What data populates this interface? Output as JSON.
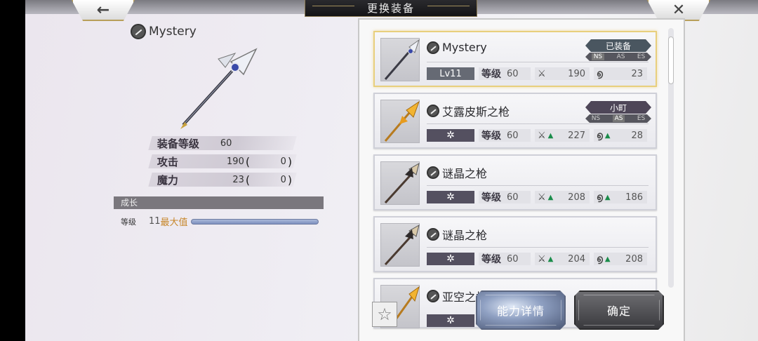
{
  "header": {
    "title": "更换装备",
    "back_icon": "←",
    "close_icon": "✕"
  },
  "selected": {
    "name": "Mystery",
    "stats": [
      {
        "label": "装备等级",
        "value": "60"
      },
      {
        "label": "攻击",
        "value": "190",
        "bonus": "0"
      },
      {
        "label": "魔力",
        "value": "23",
        "bonus": "0"
      }
    ],
    "growth": {
      "section_label": "成长",
      "label": "等级",
      "level": "11",
      "max_label": "最大值"
    }
  },
  "list": [
    {
      "name": "Mystery",
      "tag": "Lv11",
      "grade_label": "等级",
      "grade": "60",
      "atk": "190",
      "mag": "23",
      "atk_up": false,
      "mag_up": false,
      "badge": "已装备",
      "ns": [
        "NS",
        "AS",
        "ES"
      ],
      "ns_active": "NS",
      "equipped": true
    },
    {
      "name": "艾露皮斯之枪",
      "tag": "✲",
      "grade_label": "等级",
      "grade": "60",
      "atk": "227",
      "mag": "28",
      "atk_up": true,
      "mag_up": true,
      "badge": "小町",
      "ns": [
        "NS",
        "AS",
        "ES"
      ],
      "ns_active": "AS",
      "equipped": false
    },
    {
      "name": "谜晶之枪",
      "tag": "✲",
      "grade_label": "等级",
      "grade": "60",
      "atk": "208",
      "mag": "186",
      "atk_up": true,
      "mag_up": true,
      "equipped": false
    },
    {
      "name": "谜晶之枪",
      "tag": "✲",
      "grade_label": "等级",
      "grade": "60",
      "atk": "204",
      "mag": "208",
      "atk_up": true,
      "mag_up": true,
      "equipped": false
    },
    {
      "name": "亚空之枪",
      "tag": "✲",
      "equipped": false
    }
  ],
  "buttons": {
    "detail": "能力详情",
    "confirm": "确定",
    "favorite_icon": "☆"
  },
  "colors": {
    "equipped_border": "#e8cf7d",
    "stat_up": "#1a8c4a",
    "max_label": "#c7862a"
  }
}
